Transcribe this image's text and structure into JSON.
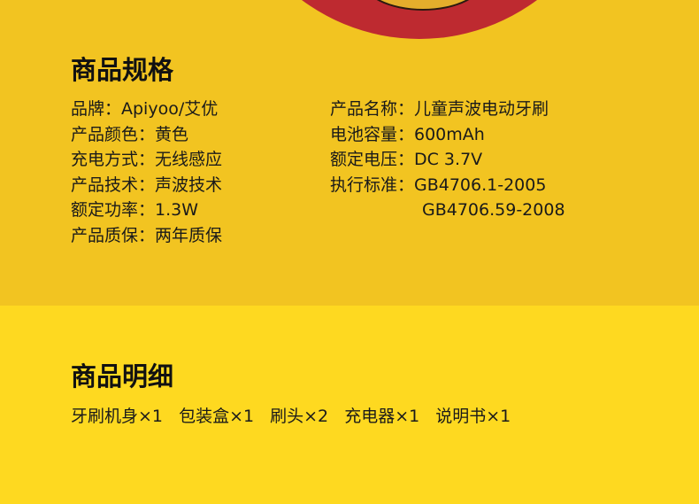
{
  "specs": {
    "title": "商品规格",
    "left": [
      "品牌：Apiyoo/艾优",
      "产品颜色：黄色",
      "充电方式：无线感应",
      "产品技术：声波技术",
      "额定功率：1.3W",
      "产品质保：两年质保"
    ],
    "right": [
      "产品名称：儿童声波电动牙刷",
      "电池容量：600mAh",
      "额定电压：DC 3.7V",
      "执行标准：GB4706.1-2005",
      "GB4706.59-2008"
    ]
  },
  "contents": {
    "title": "商品明细",
    "items": [
      "牙刷机身×1",
      "包装盒×1",
      "刷头×2",
      "充电器×1",
      "说明书×1"
    ]
  }
}
